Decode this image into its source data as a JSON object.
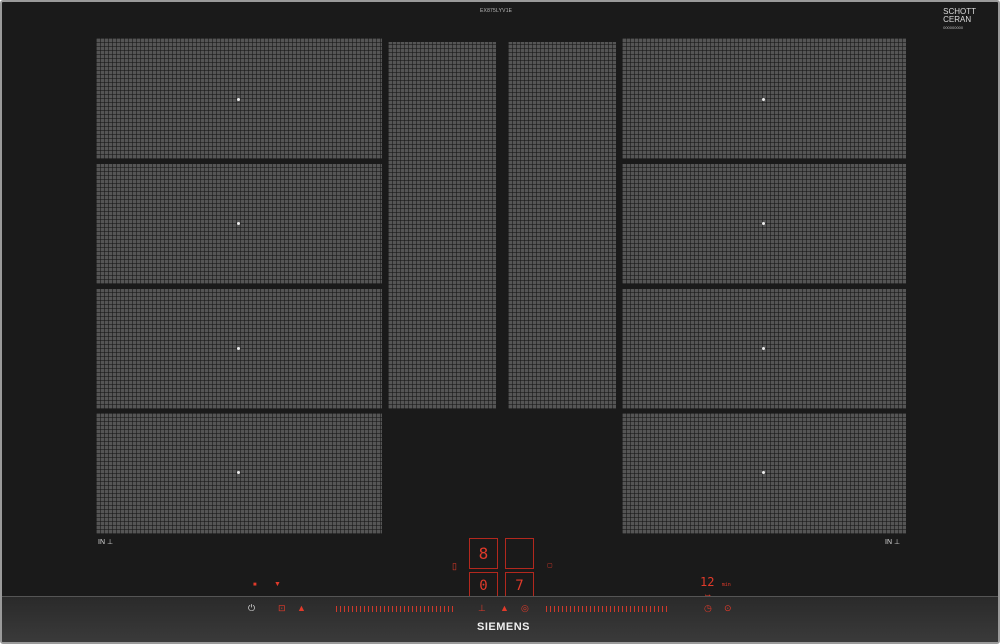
{
  "model_number": "EX875LYV1E",
  "badge": {
    "line1": "SCHOTT",
    "line2": "CERAN",
    "line3": "000000000"
  },
  "zones": {
    "left": [
      {
        "id": "L1"
      },
      {
        "id": "L2"
      },
      {
        "id": "L3"
      },
      {
        "id": "L4"
      }
    ],
    "center": [
      {
        "id": "C1"
      },
      {
        "id": "C2"
      }
    ],
    "right": [
      {
        "id": "R1"
      },
      {
        "id": "R2"
      },
      {
        "id": "R3"
      },
      {
        "id": "R4"
      }
    ]
  },
  "labels": {
    "left_in": "IN",
    "right_in": "IN"
  },
  "display": {
    "top_digit": "8",
    "left_bottom": "0",
    "right_bottom": "7",
    "timer_value": "12",
    "timer_unit": "min"
  },
  "controls": {
    "power_icon": "power-icon",
    "lock_icon": "child-lock-icon",
    "wipe_icon": "wipe-protection-icon",
    "pan_icon": "frying-sensor-icon",
    "move_icon": "move-mode-icon",
    "timer_icon": "timer-icon"
  },
  "brand": "SIEMENS",
  "colors": {
    "accent": "#e13a2a",
    "glass": "#1a1a1a",
    "grid": "#555555"
  }
}
